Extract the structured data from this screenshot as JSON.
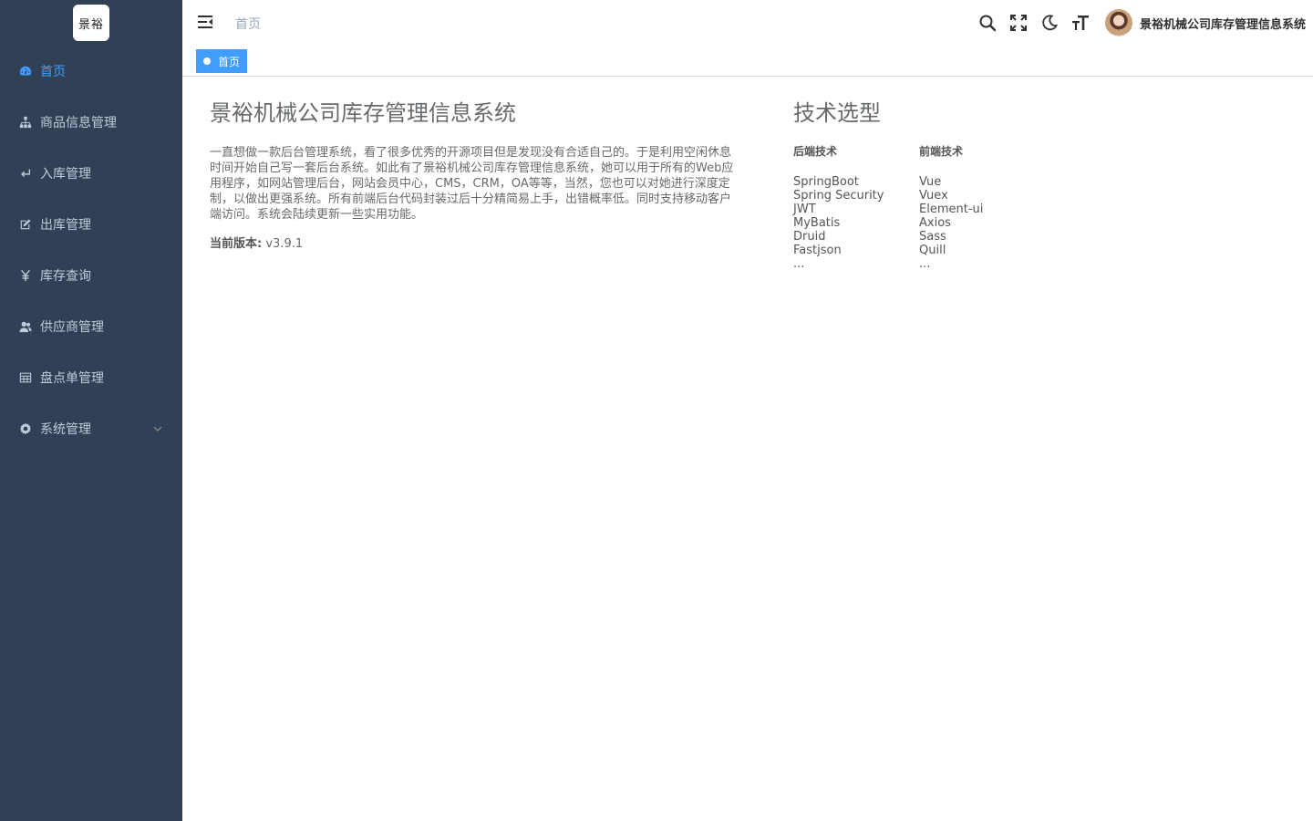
{
  "logo": {
    "text": "景裕"
  },
  "sidebar": {
    "items": [
      {
        "label": "首页",
        "icon": "dashboard-icon",
        "active": true
      },
      {
        "label": "商品信息管理",
        "icon": "tree-icon",
        "active": false
      },
      {
        "label": "入库管理",
        "icon": "return-icon",
        "active": false
      },
      {
        "label": "出库管理",
        "icon": "edit-icon",
        "active": false
      },
      {
        "label": "库存查询",
        "icon": "yen-icon",
        "active": false
      },
      {
        "label": "供应商管理",
        "icon": "people-icon",
        "active": false
      },
      {
        "label": "盘点单管理",
        "icon": "table-icon",
        "active": false
      },
      {
        "label": "系统管理",
        "icon": "gear-icon",
        "active": false,
        "has_children": true
      }
    ]
  },
  "navbar": {
    "breadcrumb": "首页",
    "username": "景裕机械公司库存管理信息系统"
  },
  "tags": [
    {
      "label": "首页",
      "active": true
    }
  ],
  "intro": {
    "title": "景裕机械公司库存管理信息系统",
    "description": "一直想做一款后台管理系统，看了很多优秀的开源项目但是发现没有合适自己的。于是利用空闲休息时间开始自己写一套后台系统。如此有了景裕机械公司库存管理信息系统，她可以用于所有的Web应用程序，如网站管理后台，网站会员中心，CMS，CRM，OA等等，当然，您也可以对她进行深度定制，以做出更强系统。所有前端后台代码封装过后十分精简易上手，出错概率低。同时支持移动客户端访问。系统会陆续更新一些实用功能。",
    "version_label": "当前版本:",
    "version_value": "v3.9.1"
  },
  "tech": {
    "title": "技术选型",
    "backend_title": "后端技术",
    "backend": [
      "SpringBoot",
      "Spring Security",
      "JWT",
      "MyBatis",
      "Druid",
      "Fastjson",
      "..."
    ],
    "frontend_title": "前端技术",
    "frontend": [
      "Vue",
      "Vuex",
      "Element-ui",
      "Axios",
      "Sass",
      "Quill",
      "..."
    ]
  },
  "colors": {
    "sidebar_bg": "#304156",
    "sidebar_text": "#bfcbd9",
    "active": "#409eff",
    "text": "#676a6c"
  }
}
